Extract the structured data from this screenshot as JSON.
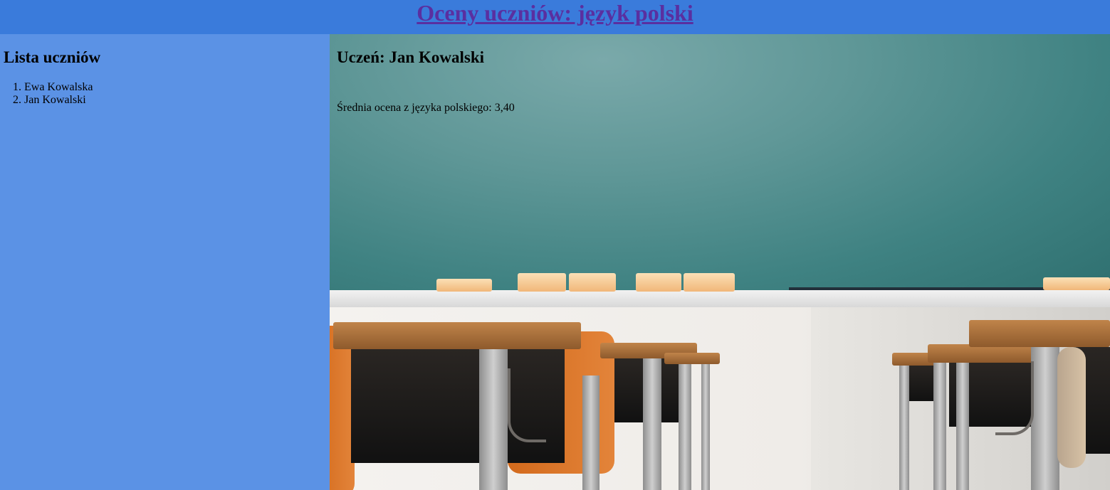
{
  "header": {
    "title": "Oceny uczniów: język polski"
  },
  "sidebar": {
    "heading": "Lista uczniów",
    "students": [
      "Ewa Kowalska",
      "Jan Kowalski"
    ]
  },
  "main": {
    "heading": "Uczeń: Jan Kowalski",
    "average_text": "Średnia ocena z języka polskiego: 3,40"
  },
  "colors": {
    "header_bg": "#3a7bdb",
    "sidebar_bg": "#5b92e5",
    "title_link": "#5a2fa0"
  }
}
